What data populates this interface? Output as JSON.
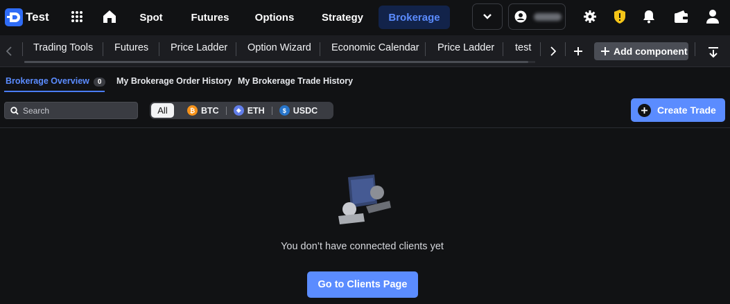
{
  "brand": {
    "name": "Test",
    "accent": "#2f6cf6"
  },
  "nav": {
    "items": [
      {
        "label": "Spot"
      },
      {
        "label": "Futures"
      },
      {
        "label": "Options"
      },
      {
        "label": "Strategy"
      },
      {
        "label": "Brokerage",
        "active": true
      }
    ]
  },
  "toolbar": {
    "tabs": [
      {
        "label": "Trading Tools"
      },
      {
        "label": "Futures"
      },
      {
        "label": "Price Ladder"
      },
      {
        "label": "Option Wizard"
      },
      {
        "label": "Economic Calendar"
      },
      {
        "label": "Price Ladder"
      },
      {
        "label": "test"
      }
    ],
    "add_component_label": "Add component"
  },
  "subtabs": [
    {
      "label": "Brokerage Overview",
      "count": "0",
      "active": true
    },
    {
      "label": "My Brokerage Order History"
    },
    {
      "label": "My Brokerage Trade History"
    }
  ],
  "filters": {
    "search_placeholder": "Search",
    "all_label": "All",
    "coins": [
      {
        "label": "BTC",
        "color": "#f7931a",
        "icon": "btc-icon"
      },
      {
        "label": "ETH",
        "color": "#627eea",
        "icon": "eth-icon"
      },
      {
        "label": "USDC",
        "color": "#2775ca",
        "icon": "usdc-icon"
      }
    ]
  },
  "actions": {
    "create_trade_label": "Create Trade"
  },
  "empty_state": {
    "message": "You don’t have connected clients yet",
    "button_label": "Go to Clients Page"
  },
  "colors": {
    "primary": "#5b8cff",
    "background": "#111214",
    "toolbar": "#1c1d21",
    "warning": "#f5c518"
  }
}
